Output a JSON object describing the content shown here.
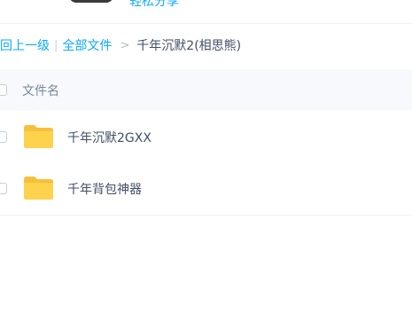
{
  "top": {
    "link_text": "轻松分享"
  },
  "breadcrumb": {
    "back_label": "回上一级",
    "separator": "|",
    "all_files_label": "全部文件",
    "arrow": ">",
    "current_folder": "千年沉默2(相思熊)"
  },
  "list": {
    "header": {
      "name_column": "文件名"
    },
    "items": [
      {
        "name": "千年沉默2GXX",
        "type": "folder"
      },
      {
        "name": "千年背包神器",
        "type": "folder"
      }
    ]
  },
  "colors": {
    "accent": "#09aaff",
    "folder": "#ffd24d",
    "text": "#424e67",
    "header_bg": "#f7f9fc"
  }
}
